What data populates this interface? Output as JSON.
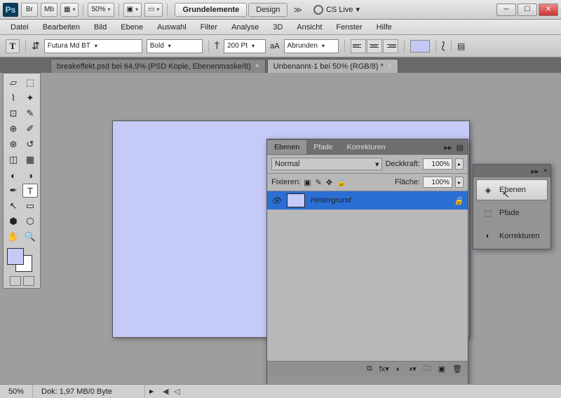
{
  "titlebar": {
    "buttons": {
      "br": "Br",
      "mb": "Mb"
    },
    "zoom": "50%",
    "workspace": {
      "active": "Grundelemente",
      "other": "Design"
    },
    "cslive": "CS Live"
  },
  "menu": [
    "Datei",
    "Bearbeiten",
    "Bild",
    "Ebene",
    "Auswahl",
    "Filter",
    "Analyse",
    "3D",
    "Ansicht",
    "Fenster",
    "Hilfe"
  ],
  "options": {
    "font": "Futura Md BT",
    "weight": "Bold",
    "size": "200 Pt",
    "aa_label": "aA",
    "aa": "Abrunden",
    "tool_letter": "T"
  },
  "tabs": [
    {
      "label": "breakeffekt.psd bei 64,9% (PSD Kopie, Ebenenmaske/8)",
      "active": false
    },
    {
      "label": "Unbenannt-1 bei 50% (RGB/8) *",
      "active": true
    }
  ],
  "layers_panel": {
    "tabs": [
      "Ebenen",
      "Pfade",
      "Korrekturen"
    ],
    "blend": "Normal",
    "opacity_label": "Deckkraft:",
    "opacity": "100%",
    "lock_label": "Fixieren:",
    "fill_label": "Fläche:",
    "fill": "100%",
    "layer_name": "Hintergrund"
  },
  "side_panel": {
    "items": [
      "Ebenen",
      "Pfade",
      "Korrekturen"
    ]
  },
  "status": {
    "zoom": "50%",
    "doc": "Dok: 1,97 MB/0 Byte"
  }
}
